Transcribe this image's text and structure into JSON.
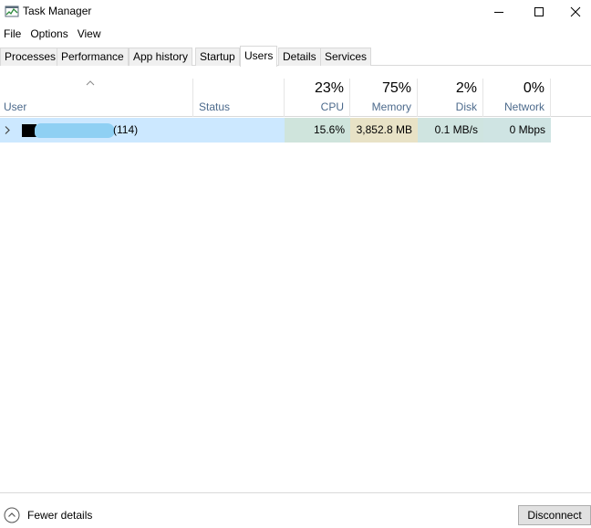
{
  "window": {
    "title": "Task Manager"
  },
  "menu": [
    "File",
    "Options",
    "View"
  ],
  "tabs": [
    {
      "label": "Processes"
    },
    {
      "label": "Performance"
    },
    {
      "label": "App history"
    },
    {
      "label": "Startup"
    },
    {
      "label": "Users",
      "active": true
    },
    {
      "label": "Details"
    },
    {
      "label": "Services"
    }
  ],
  "columns": {
    "user": {
      "label": "User"
    },
    "status": {
      "label": "Status"
    },
    "cpu": {
      "percent": "23%",
      "label": "CPU"
    },
    "memory": {
      "percent": "75%",
      "label": "Memory"
    },
    "disk": {
      "percent": "2%",
      "label": "Disk"
    },
    "network": {
      "percent": "0%",
      "label": "Network"
    }
  },
  "rows": [
    {
      "user_process_count": "(114)",
      "status": "",
      "cpu": "15.6%",
      "memory": "3,852.8 MB",
      "disk": "0.1 MB/s",
      "network": "0 Mbps"
    }
  ],
  "footer": {
    "fewer_details": "Fewer details",
    "disconnect": "Disconnect"
  },
  "icons": {
    "app": "task-manager-icon",
    "sort": "sort-ascending-icon",
    "expand": "chevron-right-icon",
    "fewer": "chevron-up-circle-icon"
  },
  "colors": {
    "selected_row": "#cce8ff",
    "cpu_heat": "#cfe4dc",
    "memory_heat": "#e8e2c6",
    "disk_heat": "#cfe4e0",
    "network_heat": "#cfe4e3",
    "header_label": "#4c6a8c"
  }
}
